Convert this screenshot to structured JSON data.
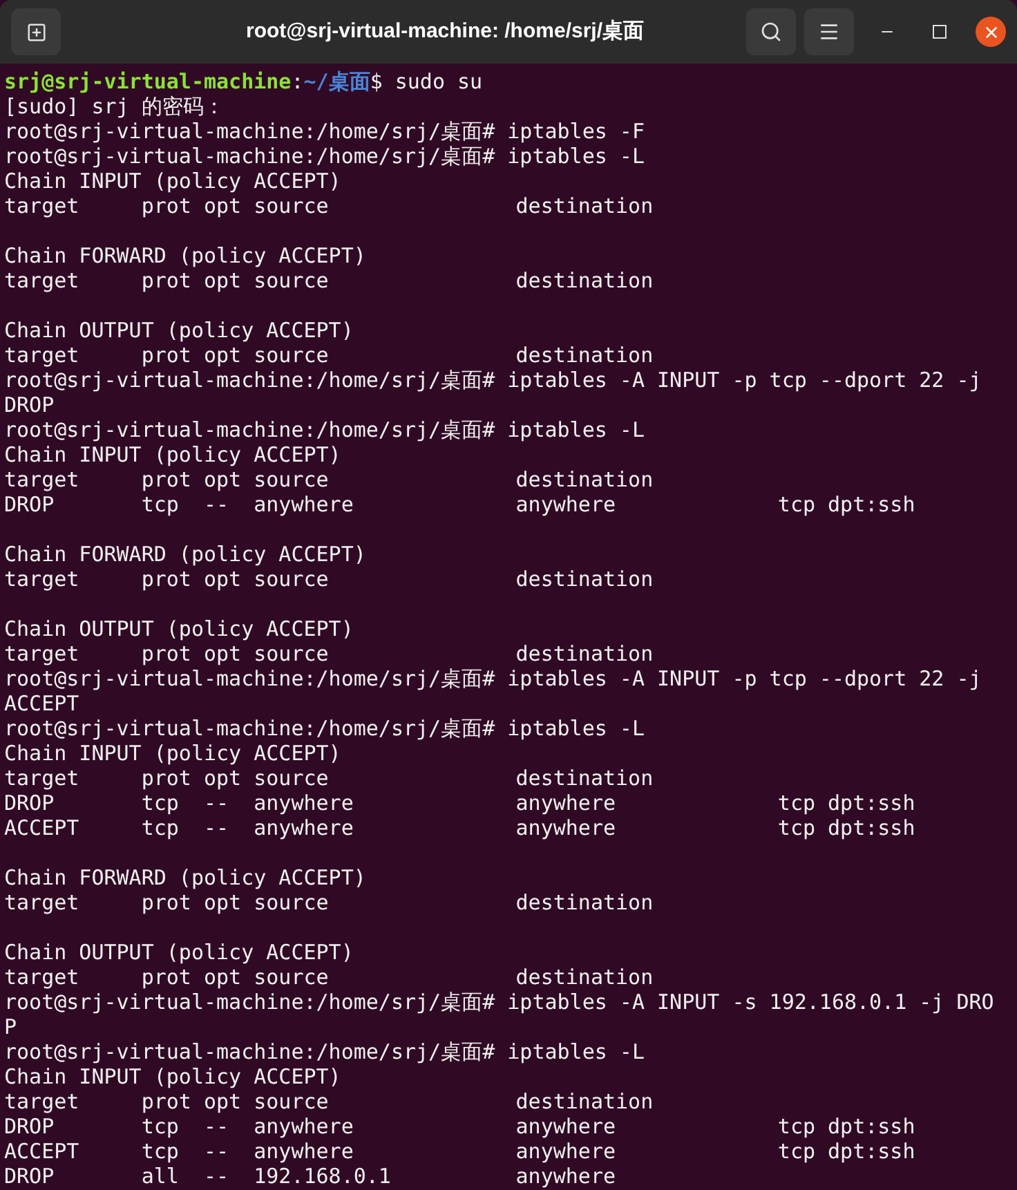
{
  "window": {
    "title": "root@srj-virtual-machine: /home/srj/桌面"
  },
  "terminal": {
    "lines": [
      {
        "kind": "colored",
        "parts": [
          {
            "text": "srj@srj-virtual-machine",
            "kind": "user"
          },
          {
            "text": ":",
            "kind": "plain"
          },
          {
            "text": "~/桌面",
            "kind": "path"
          },
          {
            "text": "$ sudo su",
            "kind": "plain"
          }
        ]
      },
      {
        "kind": "text",
        "text": "[sudo] srj 的密码："
      },
      {
        "kind": "text",
        "text": "root@srj-virtual-machine:/home/srj/桌面# iptables -F"
      },
      {
        "kind": "text",
        "text": "root@srj-virtual-machine:/home/srj/桌面# iptables -L"
      },
      {
        "kind": "text",
        "text": "Chain INPUT (policy ACCEPT)"
      },
      {
        "kind": "text",
        "text": "target     prot opt source               destination"
      },
      {
        "kind": "blank"
      },
      {
        "kind": "text",
        "text": "Chain FORWARD (policy ACCEPT)"
      },
      {
        "kind": "text",
        "text": "target     prot opt source               destination"
      },
      {
        "kind": "blank"
      },
      {
        "kind": "text",
        "text": "Chain OUTPUT (policy ACCEPT)"
      },
      {
        "kind": "text",
        "text": "target     prot opt source               destination"
      },
      {
        "kind": "text",
        "text": "root@srj-virtual-machine:/home/srj/桌面# iptables -A INPUT -p tcp --dport 22 -j"
      },
      {
        "kind": "text",
        "text": "DROP"
      },
      {
        "kind": "text",
        "text": "root@srj-virtual-machine:/home/srj/桌面# iptables -L"
      },
      {
        "kind": "text",
        "text": "Chain INPUT (policy ACCEPT)"
      },
      {
        "kind": "text",
        "text": "target     prot opt source               destination"
      },
      {
        "kind": "text",
        "text": "DROP       tcp  --  anywhere             anywhere             tcp dpt:ssh"
      },
      {
        "kind": "blank"
      },
      {
        "kind": "text",
        "text": "Chain FORWARD (policy ACCEPT)"
      },
      {
        "kind": "text",
        "text": "target     prot opt source               destination"
      },
      {
        "kind": "blank"
      },
      {
        "kind": "text",
        "text": "Chain OUTPUT (policy ACCEPT)"
      },
      {
        "kind": "text",
        "text": "target     prot opt source               destination"
      },
      {
        "kind": "text",
        "text": "root@srj-virtual-machine:/home/srj/桌面# iptables -A INPUT -p tcp --dport 22 -j"
      },
      {
        "kind": "text",
        "text": "ACCEPT"
      },
      {
        "kind": "text",
        "text": "root@srj-virtual-machine:/home/srj/桌面# iptables -L"
      },
      {
        "kind": "text",
        "text": "Chain INPUT (policy ACCEPT)"
      },
      {
        "kind": "text",
        "text": "target     prot opt source               destination"
      },
      {
        "kind": "text",
        "text": "DROP       tcp  --  anywhere             anywhere             tcp dpt:ssh"
      },
      {
        "kind": "text",
        "text": "ACCEPT     tcp  --  anywhere             anywhere             tcp dpt:ssh"
      },
      {
        "kind": "blank"
      },
      {
        "kind": "text",
        "text": "Chain FORWARD (policy ACCEPT)"
      },
      {
        "kind": "text",
        "text": "target     prot opt source               destination"
      },
      {
        "kind": "blank"
      },
      {
        "kind": "text",
        "text": "Chain OUTPUT (policy ACCEPT)"
      },
      {
        "kind": "text",
        "text": "target     prot opt source               destination"
      },
      {
        "kind": "text",
        "text": "root@srj-virtual-machine:/home/srj/桌面# iptables -A INPUT -s 192.168.0.1 -j DRO"
      },
      {
        "kind": "text",
        "text": "P"
      },
      {
        "kind": "text",
        "text": "root@srj-virtual-machine:/home/srj/桌面# iptables -L"
      },
      {
        "kind": "text",
        "text": "Chain INPUT (policy ACCEPT)"
      },
      {
        "kind": "text",
        "text": "target     prot opt source               destination"
      },
      {
        "kind": "text",
        "text": "DROP       tcp  --  anywhere             anywhere             tcp dpt:ssh"
      },
      {
        "kind": "text",
        "text": "ACCEPT     tcp  --  anywhere             anywhere             tcp dpt:ssh"
      },
      {
        "kind": "text",
        "text": "DROP       all  --  192.168.0.1          anywhere"
      }
    ]
  }
}
